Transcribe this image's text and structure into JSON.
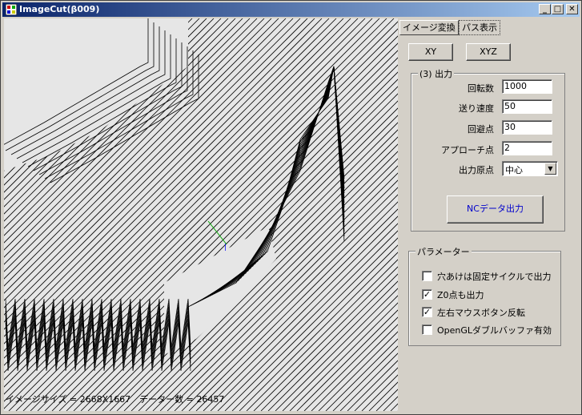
{
  "window": {
    "title": "ImageCut(β009)",
    "minimize_label": "_",
    "maximize_label": "□",
    "close_label": "✕"
  },
  "tabs": [
    {
      "label": "イメージ変換",
      "active": false
    },
    {
      "label": "パス表示",
      "active": true
    }
  ],
  "view_buttons": {
    "xy": "XY",
    "xyz": "XYZ"
  },
  "output_group": {
    "legend": "(3) 出力",
    "fields": [
      {
        "label": "回転数",
        "value": "1000"
      },
      {
        "label": "送り速度",
        "value": "50"
      },
      {
        "label": "回避点",
        "value": "30"
      },
      {
        "label": "アプローチ点",
        "value": "2"
      }
    ],
    "origin_label": "出力原点",
    "origin_value": "中心",
    "nc_button": "NCデータ出力"
  },
  "param_group": {
    "legend": "パラメーター",
    "options": [
      {
        "label": "穴あけは固定サイクルで出力",
        "checked": false
      },
      {
        "label": "Z0点も出力",
        "checked": true
      },
      {
        "label": "左右マウスボタン反転",
        "checked": true
      },
      {
        "label": "OpenGLダブルバッファ有効",
        "checked": false
      }
    ]
  },
  "status": "イメージサイズ = 2668X1667　データー数 = 26457",
  "colors": {
    "accent_link": "#0000cc",
    "axis_green": "#00a000",
    "axis_blue": "#0000ff"
  }
}
